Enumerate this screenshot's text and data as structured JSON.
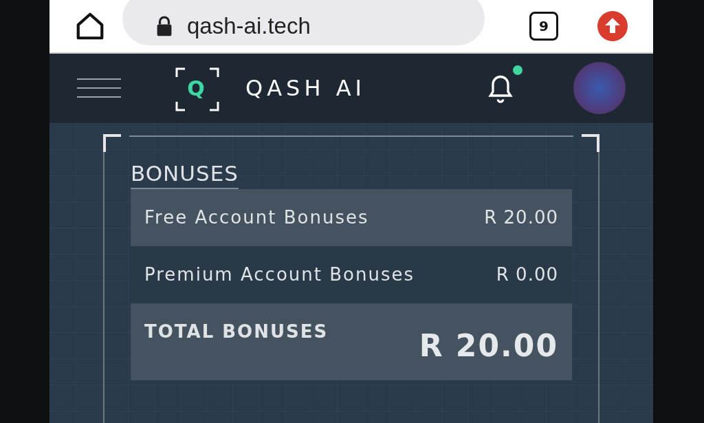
{
  "browser": {
    "url": "qash-ai.tech",
    "tab_count": "9"
  },
  "header": {
    "logo_letter": "Q",
    "brand": "QASH AI",
    "has_notification": true
  },
  "bonuses": {
    "title": "BONUSES",
    "rows": [
      {
        "kind": "item",
        "highlighted": true,
        "label": "Free Account Bonuses",
        "amount": "R 20.00"
      },
      {
        "kind": "item",
        "highlighted": false,
        "label": "Premium Account Bonuses",
        "amount": "R 0.00"
      },
      {
        "kind": "total",
        "highlighted": true,
        "label": "TOTAL BONUSES",
        "amount": "R 20.00"
      }
    ]
  }
}
